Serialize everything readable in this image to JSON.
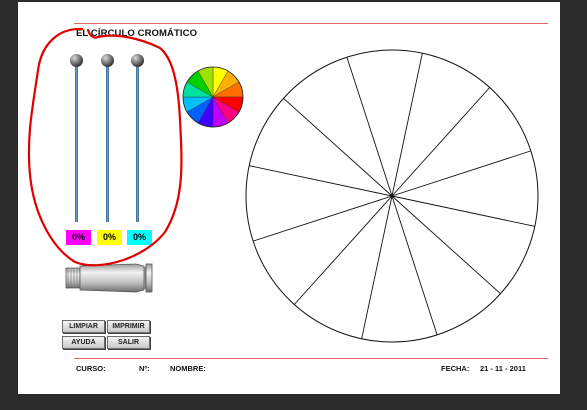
{
  "app": {
    "title": "EL CÍRCULO CROMÁTICO"
  },
  "sliders": [
    {
      "name": "magenta",
      "value_label": "0%",
      "value": 0,
      "color": "#ff00ff"
    },
    {
      "name": "yellow",
      "value_label": "0%",
      "value": 0,
      "color": "#ffff00"
    },
    {
      "name": "cyan",
      "value_label": "0%",
      "value": 0,
      "color": "#00ffff"
    }
  ],
  "buttons": {
    "limpiar": "LIMPIAR",
    "imprimir": "IMPRIMIR",
    "ayuda": "AYUDA",
    "salir": "SALIR"
  },
  "footer": {
    "curso_label": "CURSO:",
    "numero_label": "Nº:",
    "nombre_label": "NOMBRE:",
    "fecha_label": "FECHA:",
    "fecha_value": "21 - 11 - 2011"
  },
  "colors": {
    "accent_rule": "#e06666",
    "annotation": "#e00000",
    "wheel": [
      "#ffff00",
      "#ffb000",
      "#ff7000",
      "#ff0000",
      "#ff0080",
      "#c000ff",
      "#4000ff",
      "#0060ff",
      "#00c0ff",
      "#00e0a0",
      "#00d000",
      "#a0e000"
    ]
  },
  "wheel": {
    "segments": 12
  }
}
